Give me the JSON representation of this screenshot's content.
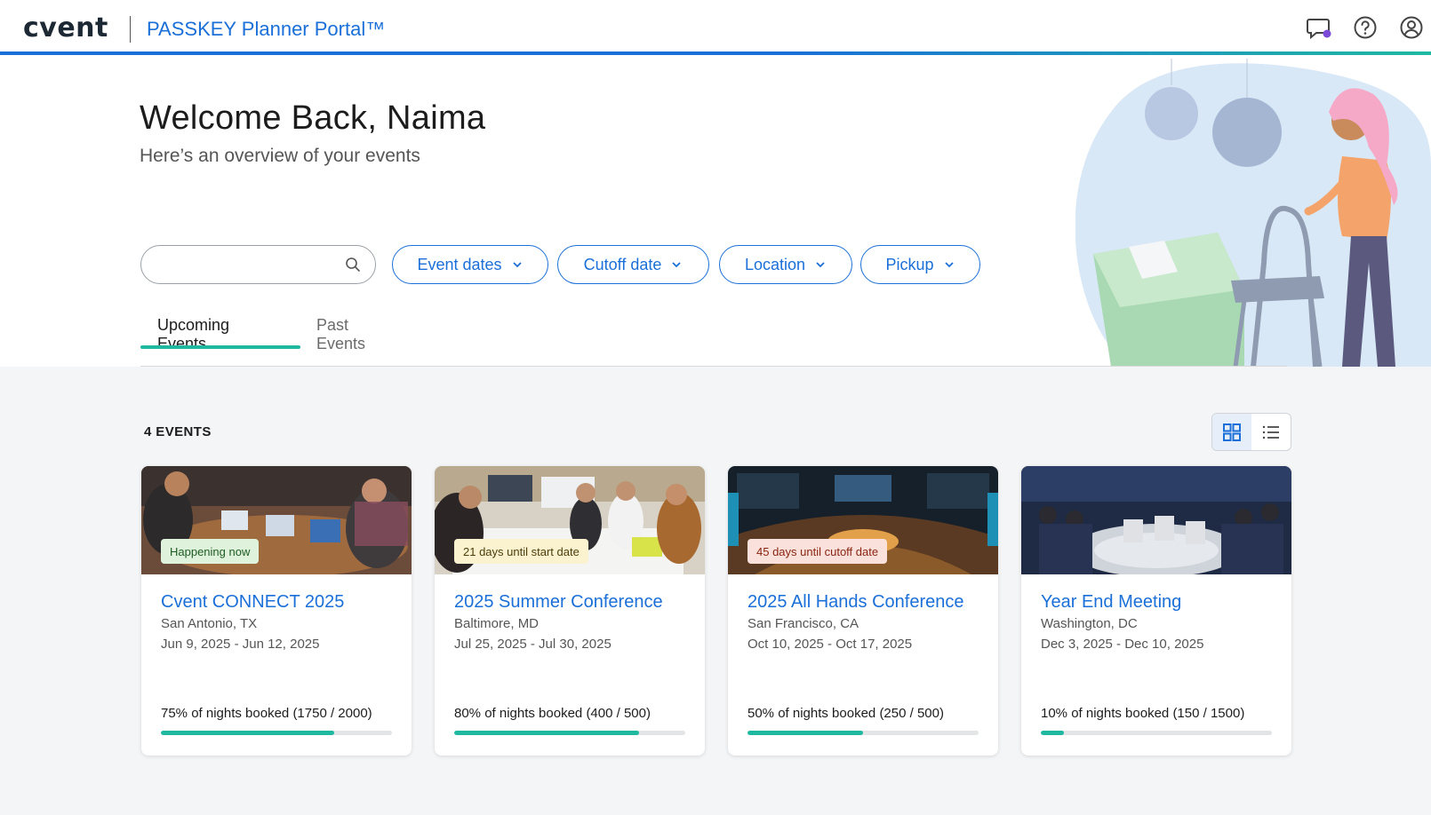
{
  "header": {
    "logo": "cvent",
    "portal_title": "PASSKEY Planner Portal™",
    "icons": [
      "chat-icon",
      "help-icon",
      "account-icon"
    ]
  },
  "hero": {
    "welcome": "Welcome Back, Naima",
    "subtitle": "Here’s an overview of your events"
  },
  "search": {
    "value": "",
    "placeholder": ""
  },
  "filters": [
    {
      "label": "Event dates"
    },
    {
      "label": "Cutoff date"
    },
    {
      "label": "Location"
    },
    {
      "label": "Pickup"
    }
  ],
  "tabs": [
    {
      "label": "Upcoming Events",
      "active": true
    },
    {
      "label": "Past Events",
      "active": false
    }
  ],
  "events_count": "4 EVENTS",
  "view_toggle": {
    "active": "grid"
  },
  "colors": {
    "brand_blue": "#1a6fd8",
    "accent_teal": "#1fb9a2",
    "badge_green_bg": "#dff3dc",
    "badge_yellow_bg": "#fbf3cf",
    "badge_red_bg": "#fbe1dc"
  },
  "events": [
    {
      "title": "Cvent CONNECT 2025",
      "location": "San Antonio, TX",
      "dates": "Jun 9, 2025 - Jun 12, 2025",
      "badge": "Happening now",
      "badge_tone": "green",
      "booked": "75% of nights booked (1750 / 2000)",
      "progress": 0.75
    },
    {
      "title": "2025 Summer Conference",
      "location": "Baltimore, MD",
      "dates": "Jul 25, 2025 - Jul 30, 2025",
      "badge": "21 days until start date",
      "badge_tone": "yellow",
      "booked": "80% of nights booked (400 / 500)",
      "progress": 0.8
    },
    {
      "title": "2025 All Hands Conference",
      "location": "San Francisco, CA",
      "dates": "Oct 10, 2025 - Oct 17, 2025",
      "badge": "45 days until cutoff date",
      "badge_tone": "red",
      "booked": "50% of nights booked (250 / 500)",
      "progress": 0.5
    },
    {
      "title": "Year End Meeting",
      "location": "Washington, DC",
      "dates": "Dec 3, 2025 - Dec 10, 2025",
      "badge": "",
      "badge_tone": "none",
      "booked": "10% of nights booked (150 / 1500)",
      "progress": 0.1
    }
  ]
}
